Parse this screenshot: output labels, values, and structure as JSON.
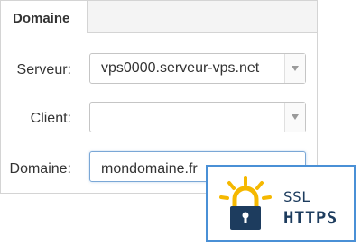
{
  "tab": {
    "label": "Domaine"
  },
  "form": {
    "server": {
      "label": "Serveur:",
      "value": "vps0000.serveur-vps.net"
    },
    "client": {
      "label": "Client:",
      "value": ""
    },
    "domain": {
      "label": "Domaine:",
      "value": "mondomaine.fr"
    }
  },
  "badge": {
    "ssl": "SSL",
    "https": "HTTPS",
    "icon": "padlock-sun-icon",
    "colors": {
      "sun": "#f5b800",
      "lock": "#1d3c5e",
      "border": "#4a90d6"
    }
  }
}
